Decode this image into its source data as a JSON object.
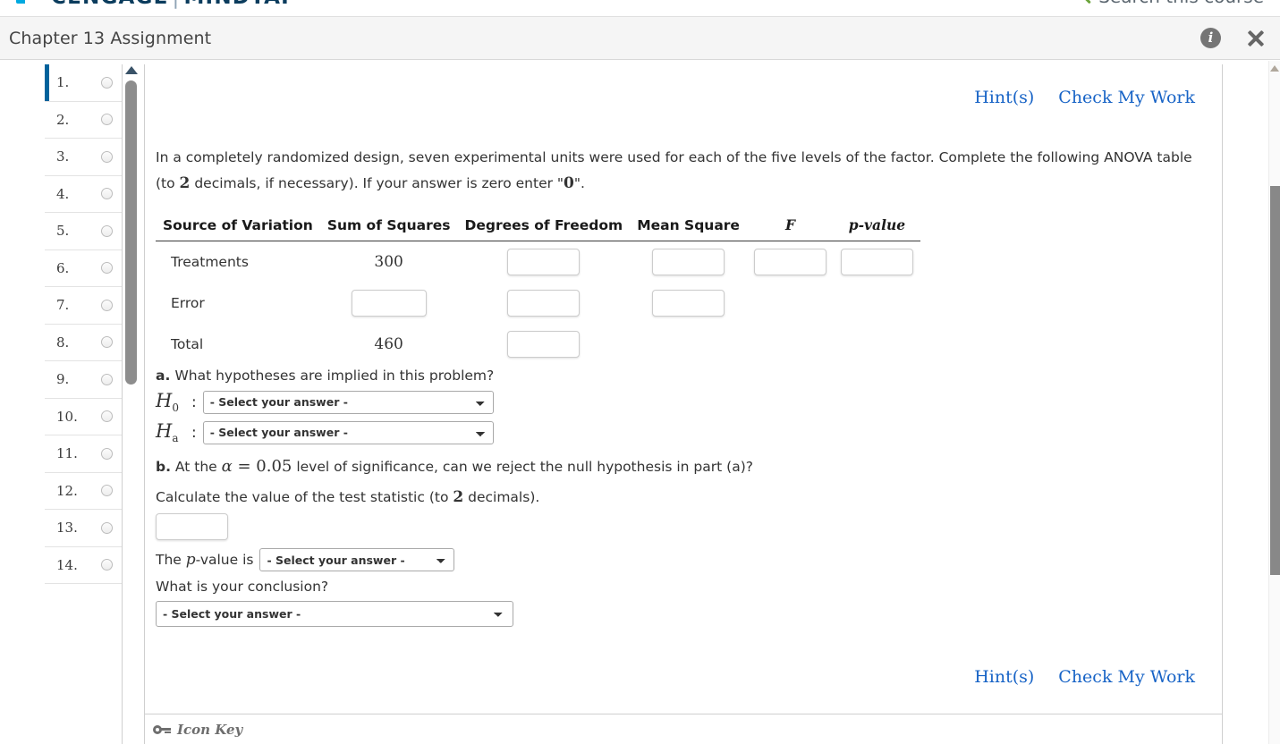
{
  "brand": {
    "logo_primary": "CENGAGE",
    "logo_separator": "|",
    "logo_secondary": "MINDTAP",
    "search_label": "Search this course",
    "search_icon": "search-icon",
    "blue": "#00629B",
    "green": "#6BA43A",
    "link_blue": "#1763c6"
  },
  "header": {
    "title": "Chapter 13 Assignment",
    "info_icon": "info-icon",
    "info_glyph": "i",
    "close_icon": "close-icon"
  },
  "question_list": {
    "items": [
      {
        "label": "1.",
        "active": true
      },
      {
        "label": "2.",
        "active": false
      },
      {
        "label": "3.",
        "active": false
      },
      {
        "label": "4.",
        "active": false
      },
      {
        "label": "5.",
        "active": false
      },
      {
        "label": "6.",
        "active": false
      },
      {
        "label": "7.",
        "active": false
      },
      {
        "label": "8.",
        "active": false
      },
      {
        "label": "9.",
        "active": false
      },
      {
        "label": "10.",
        "active": false
      },
      {
        "label": "11.",
        "active": false
      },
      {
        "label": "12.",
        "active": false
      },
      {
        "label": "13.",
        "active": false
      },
      {
        "label": "14.",
        "active": false
      }
    ]
  },
  "links": {
    "hints": "Hint(s)",
    "check_my_work": "Check My Work"
  },
  "question": {
    "prompt_part1": "In a completely randomized design, seven experimental units were used for each of the five levels of the factor. Complete the following ANOVA table (to ",
    "prompt_decimals": "2",
    "prompt_part2": " decimals, if necessary). If your answer is zero enter \"",
    "prompt_zero": "0",
    "prompt_part3": "\"."
  },
  "anova_table": {
    "headers": [
      "Source of Variation",
      "Sum of Squares",
      "Degrees of Freedom",
      "Mean Square",
      "F",
      "p-value"
    ],
    "rows": [
      {
        "source": "Treatments",
        "sum_of_squares": {
          "type": "value",
          "text": "300"
        },
        "degrees_of_freedom": {
          "type": "input",
          "value": ""
        },
        "mean_square": {
          "type": "input",
          "value": ""
        },
        "f": {
          "type": "input",
          "value": ""
        },
        "p_value": {
          "type": "input",
          "value": ""
        }
      },
      {
        "source": "Error",
        "sum_of_squares": {
          "type": "input",
          "value": ""
        },
        "degrees_of_freedom": {
          "type": "input",
          "value": ""
        },
        "mean_square": {
          "type": "input",
          "value": ""
        },
        "f": {
          "type": "empty"
        },
        "p_value": {
          "type": "empty"
        }
      },
      {
        "source": "Total",
        "sum_of_squares": {
          "type": "value",
          "text": "460"
        },
        "degrees_of_freedom": {
          "type": "input",
          "value": ""
        },
        "mean_square": {
          "type": "empty"
        },
        "f": {
          "type": "empty"
        },
        "p_value": {
          "type": "empty"
        }
      }
    ]
  },
  "part_a": {
    "label": "a.",
    "question": "What hypotheses are implied in this problem?",
    "null_symbol": "H",
    "null_sub": "0",
    "alt_symbol": "H",
    "alt_sub": "a",
    "colon": ":",
    "select_placeholder": "- Select your answer -",
    "h0_value": "- Select your answer -",
    "ha_value": "- Select your answer -"
  },
  "part_b": {
    "label": "b.",
    "text_before": "At the ",
    "alpha_symbol": "α",
    "alpha_equation": " = 0.05",
    "text_after": " level of significance, can we reject the null hypothesis in part (a)?",
    "calc_text_before": "Calculate the value of the test statistic (to ",
    "calc_decimals": "2",
    "calc_text_after": " decimals).",
    "test_statistic_value": "",
    "pvalue_text_before": "The ",
    "pvalue_p": "p",
    "pvalue_text_after": "-value is",
    "pvalue_select": "- Select your answer -",
    "conclusion_question": "What is your conclusion?",
    "conclusion_select": "- Select your answer -"
  },
  "footer": {
    "icon_key_label": "Icon Key",
    "key_icon": "key-icon"
  }
}
